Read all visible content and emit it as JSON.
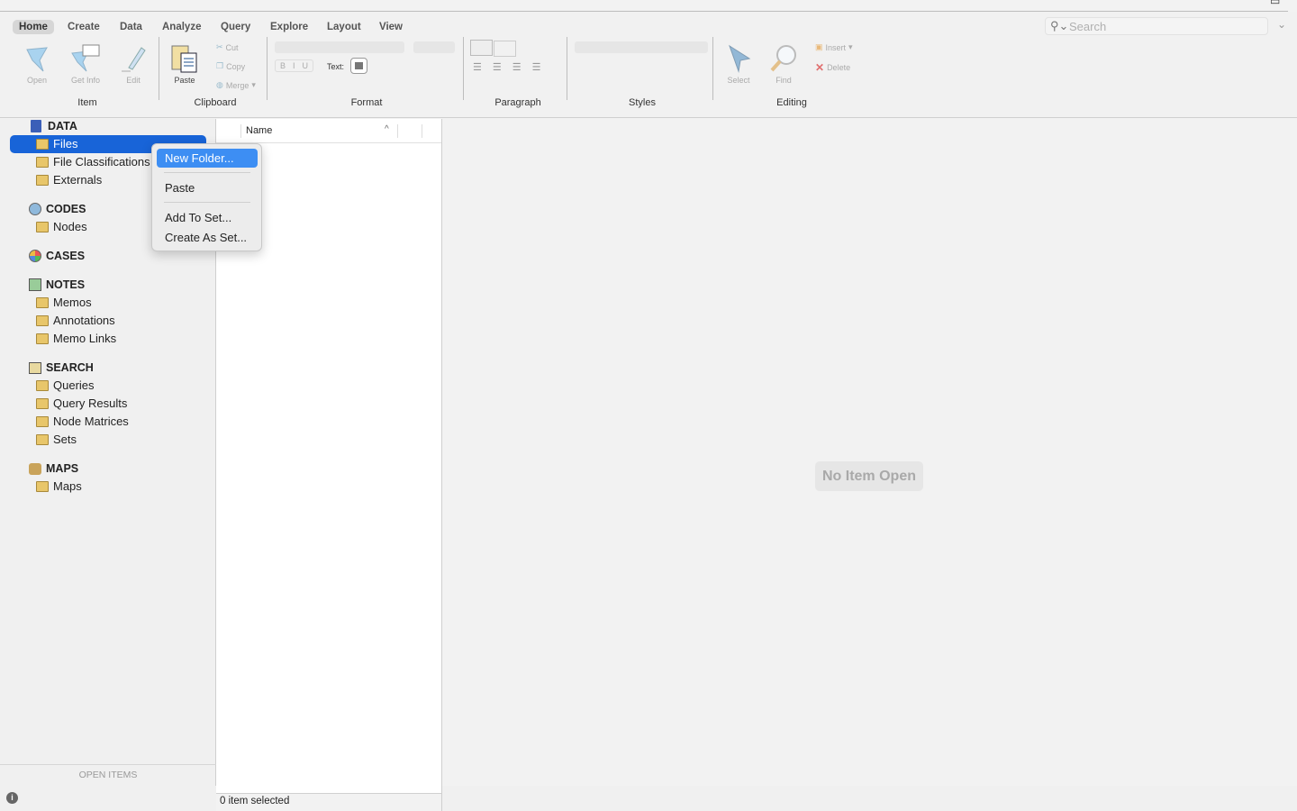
{
  "ribbon": {
    "tabs": [
      "Home",
      "Create",
      "Data",
      "Analyze",
      "Query",
      "Explore",
      "Layout",
      "View"
    ],
    "active_tab": "Home",
    "groups": {
      "item": {
        "label": "Item",
        "buttons": [
          "Open",
          "Get Info",
          "Edit"
        ]
      },
      "clipboard": {
        "label": "Clipboard",
        "paste": "Paste",
        "cut": "Cut",
        "copy": "Copy",
        "merge": "Merge"
      },
      "format": {
        "label": "Format",
        "bold": "B",
        "italic": "I",
        "underline": "U",
        "text_label": "Text:"
      },
      "paragraph": {
        "label": "Paragraph"
      },
      "styles": {
        "label": "Styles"
      },
      "editing": {
        "label": "Editing",
        "select": "Select",
        "find": "Find",
        "insert": "Insert",
        "delete": "Delete"
      }
    }
  },
  "search": {
    "placeholder": "Search"
  },
  "sidebar": {
    "sections": [
      {
        "title": "DATA",
        "icon": "book-icon",
        "items": [
          "Files",
          "File Classifications",
          "Externals"
        ]
      },
      {
        "title": "CODES",
        "icon": "sphere-icon",
        "items": [
          "Nodes"
        ]
      },
      {
        "title": "CASES",
        "icon": "cases-icon",
        "items": []
      },
      {
        "title": "NOTES",
        "icon": "notes-icon",
        "items": [
          "Memos",
          "Annotations",
          "Memo Links"
        ]
      },
      {
        "title": "SEARCH",
        "icon": "search-folder-icon",
        "items": [
          "Queries",
          "Query Results",
          "Node Matrices",
          "Sets"
        ]
      },
      {
        "title": "MAPS",
        "icon": "maps-icon",
        "items": [
          "Maps"
        ]
      }
    ],
    "selected": "Files",
    "open_items": "OPEN ITEMS"
  },
  "list": {
    "column_name": "Name",
    "status": "0 item selected"
  },
  "main": {
    "empty_text": "No Item Open"
  },
  "context_menu": {
    "items": [
      "New Folder...",
      "Paste",
      "Add To Set...",
      "Create As Set..."
    ],
    "highlighted": "New Folder..."
  },
  "colors": {
    "selection": "#1864d8",
    "menu_highlight": "#3d8ef3"
  }
}
